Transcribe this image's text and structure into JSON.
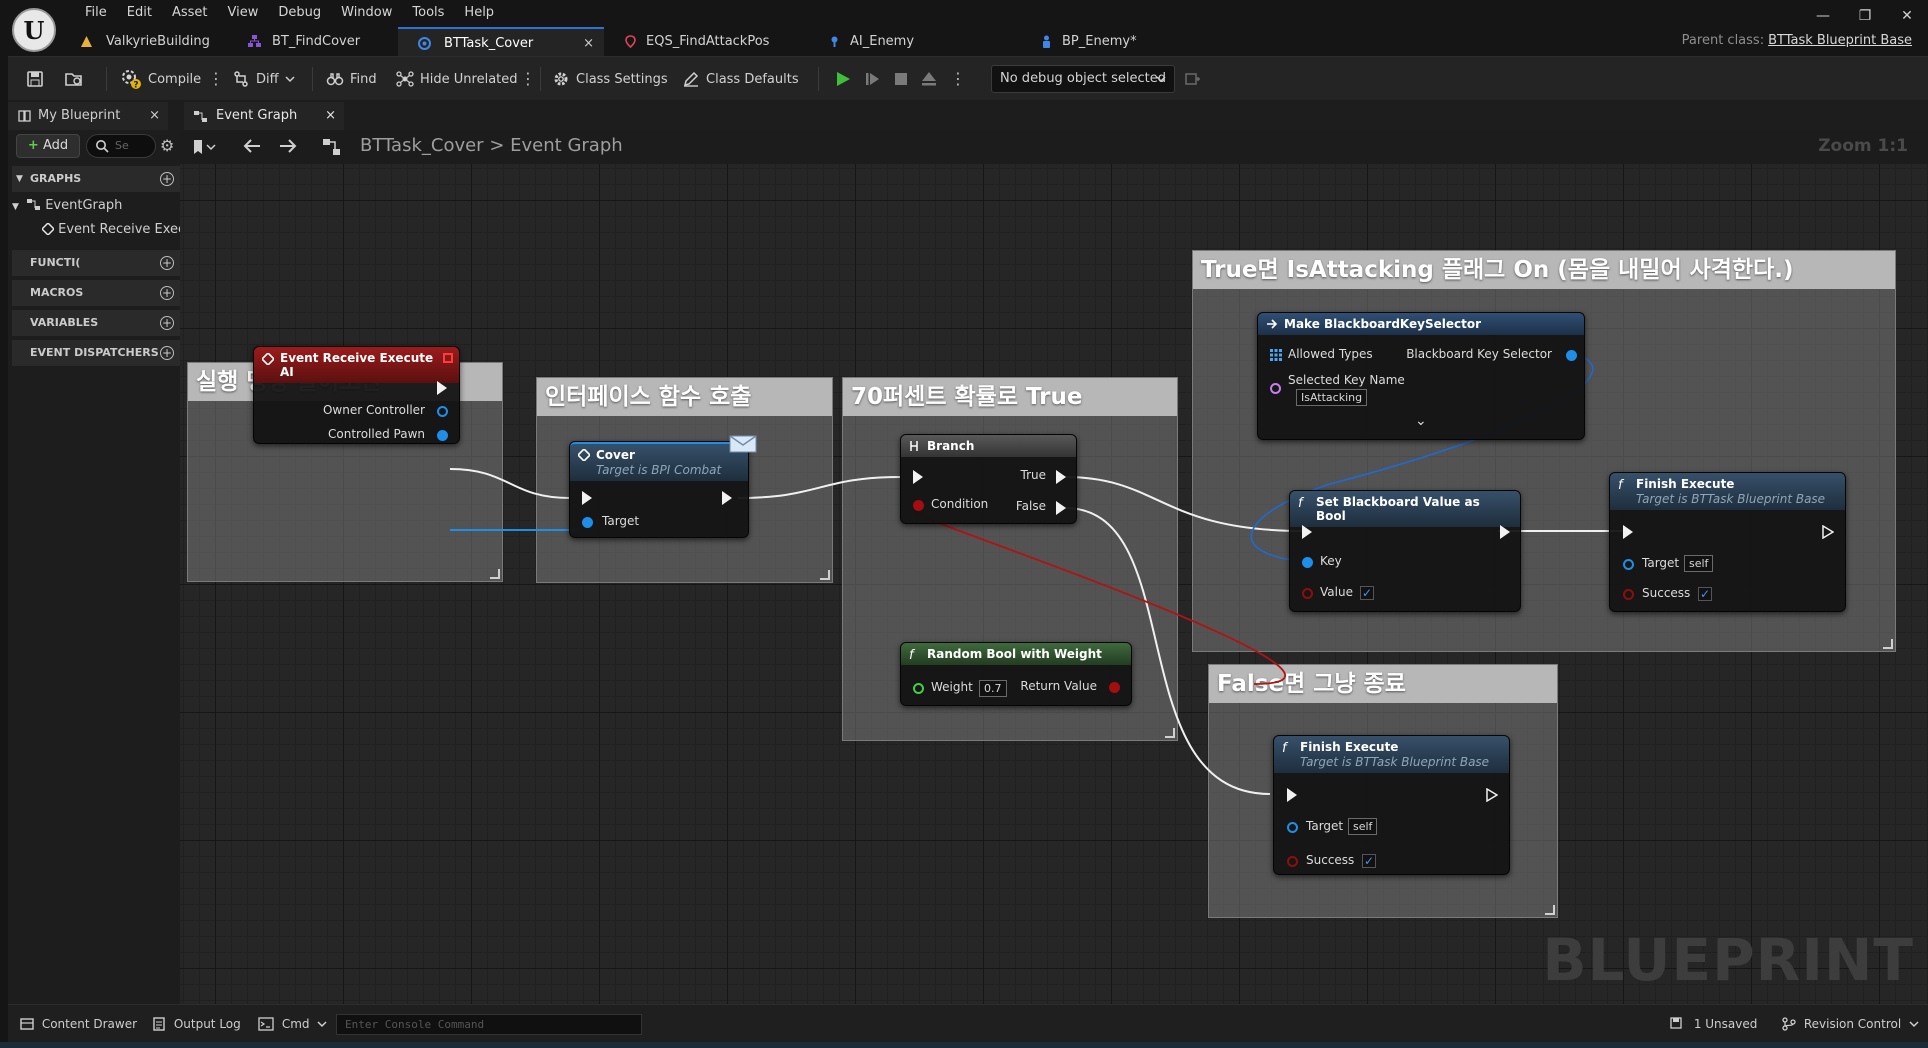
{
  "logo": "U",
  "menu": [
    "File",
    "Edit",
    "Asset",
    "View",
    "Debug",
    "Window",
    "Tools",
    "Help"
  ],
  "doc_tabs": [
    {
      "label": "ValkyrieBuilding",
      "icon": "level-icon",
      "color": "#e8b13a"
    },
    {
      "label": "BT_FindCover",
      "icon": "behavior-tree-icon",
      "color": "#8a54d6"
    },
    {
      "label": "BTTask_Cover",
      "icon": "blueprint-icon",
      "color": "#3f86e8",
      "active": true,
      "close": "×"
    },
    {
      "label": "EQS_FindAttackPos",
      "icon": "eqs-icon",
      "color": "#e0435a"
    },
    {
      "label": "AI_Enemy",
      "icon": "blackboard-icon",
      "color": "#3f86e8"
    },
    {
      "label": "BP_Enemy*",
      "icon": "character-blueprint-icon",
      "color": "#3f86e8"
    }
  ],
  "window_controls": {
    "minimize": "—",
    "restore": "❐",
    "close": "✕"
  },
  "parent_class": {
    "label": "Parent class:",
    "value": "BTTask Blueprint Base"
  },
  "toolbar": {
    "compile": "Compile",
    "diff": "Diff",
    "find": "Find",
    "hide_unrelated": "Hide Unrelated",
    "class_settings": "Class Settings",
    "class_defaults": "Class Defaults",
    "debug_object": "No debug object selected"
  },
  "left_panel": {
    "tab": "My Blueprint",
    "add": "Add",
    "search_placeholder": "Se",
    "sections": {
      "graphs": "GRAPHS",
      "functions": "FUNCTI(",
      "macros": "MACROS",
      "variables": "VARIABLES",
      "dispatchers": "EVENT DISPATCHERS"
    },
    "tree": {
      "event_graph": "EventGraph",
      "event_item": "Event Receive Execu"
    }
  },
  "graph_tab": "Event Graph",
  "breadcrumb": {
    "asset": "BTTask_Cover",
    "sep": ">",
    "graph": "Event Graph"
  },
  "zoom": "Zoom 1:1",
  "watermark": "BLUEPRINT",
  "comments": {
    "c1": "실행 명령 들어오면",
    "c2": "인터페이스 함수 호출",
    "c3": "70퍼센트 확률로 True",
    "c4": "True면 IsAttacking 플래그 On (몸을 내밀어 사격한다.)",
    "c5": "False면 그냥 종료"
  },
  "nodes": {
    "event": {
      "title": "Event Receive Execute AI",
      "owner": "Owner Controller",
      "pawn": "Controlled Pawn"
    },
    "cover": {
      "title": "Cover",
      "subtitle": "Target is BPI Combat",
      "target": "Target"
    },
    "branch": {
      "title": "Branch",
      "condition": "Condition",
      "true": "True",
      "false": "False"
    },
    "random": {
      "title": "Random Bool with Weight",
      "weight": "Weight",
      "weight_value": "0.7",
      "return": "Return Value"
    },
    "make": {
      "title": "Make BlackboardKeySelector",
      "allowed": "Allowed Types",
      "selector": "Blackboard Key Selector",
      "key_name": "Selected Key Name",
      "key_value": "IsAttacking",
      "expand": "⌄"
    },
    "setbb": {
      "title": "Set Blackboard Value as Bool",
      "key": "Key",
      "value": "Value"
    },
    "finish1": {
      "title": "Finish Execute",
      "subtitle": "Target is BTTask Blueprint Base",
      "target": "Target",
      "target_value": "self",
      "success": "Success"
    },
    "finish2": {
      "title": "Finish Execute",
      "subtitle": "Target is BTTask Blueprint Base",
      "target": "Target",
      "target_value": "self",
      "success": "Success"
    }
  },
  "check_mark": "✓",
  "function_icon": "f",
  "bottom": {
    "content_drawer": "Content Drawer",
    "output_log": "Output Log",
    "cmd": "Cmd",
    "console_placeholder": "Enter Console Command",
    "unsaved": "1 Unsaved",
    "revision": "Revision Control"
  }
}
